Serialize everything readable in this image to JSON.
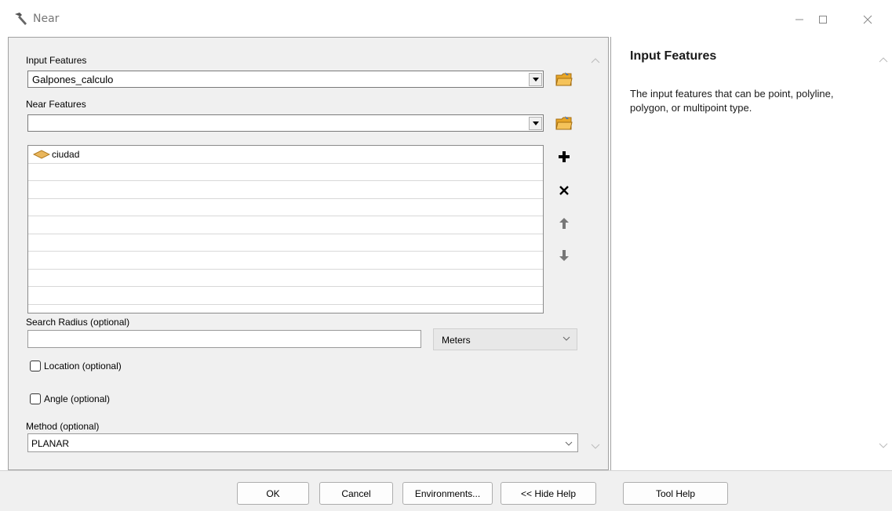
{
  "window": {
    "title": "Near",
    "title_icon": "hammer-icon",
    "controls": [
      "minimize-icon",
      "maximize-icon",
      "close-icon"
    ]
  },
  "form": {
    "input_features": {
      "label": "Input Features",
      "value": "Galpones_calculo"
    },
    "near_features": {
      "label": "Near Features",
      "value": "",
      "items": [
        {
          "label": "ciudad",
          "icon": "polygon-layer-icon"
        }
      ]
    },
    "search_radius": {
      "label": "Search Radius (optional)",
      "value": "",
      "unit": "Meters"
    },
    "location": {
      "label": "Location (optional)",
      "checked": false
    },
    "angle": {
      "label": "Angle (optional)",
      "checked": false
    },
    "method": {
      "label": "Method (optional)",
      "value": "PLANAR"
    }
  },
  "help": {
    "title": "Input Features",
    "body": "The input features that can be point, polyline, polygon, or multipoint type."
  },
  "buttons": {
    "ok": "OK",
    "cancel": "Cancel",
    "environments": "Environments...",
    "hide_help": "<< Hide Help",
    "tool_help": "Tool Help"
  },
  "colors": {
    "pane_bg": "#f0f0f0",
    "folder_icon": "#e8a628",
    "polygon_icon": "#e9b65c"
  }
}
